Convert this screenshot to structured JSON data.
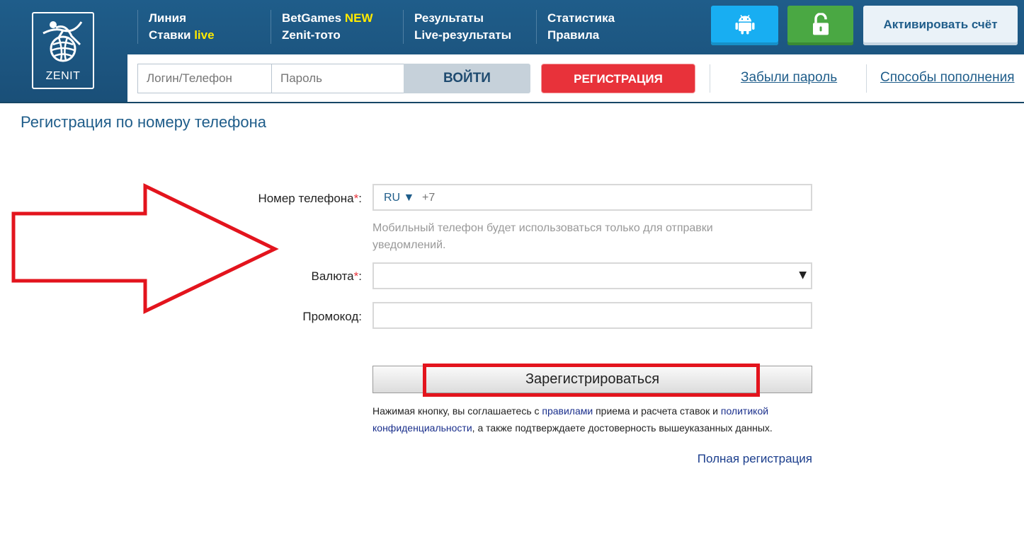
{
  "header": {
    "logo_text": "ZENIT",
    "nav": [
      {
        "line1": "Линия",
        "line2_pre": "Ставки ",
        "line2_hl": "live"
      },
      {
        "line1_pre": "BetGames ",
        "line1_hl": "NEW",
        "line2": "Zenit-тото"
      },
      {
        "line1": "Результаты",
        "line2": "Live-результаты"
      },
      {
        "line1": "Статистика",
        "line2": "Правила"
      }
    ],
    "activate_label": "Активировать счёт",
    "android_icon": "android-icon",
    "lock_icon": "unlock-icon"
  },
  "login_bar": {
    "login_placeholder": "Логин/Телефон",
    "password_placeholder": "Пароль",
    "login_button": "ВОЙТИ",
    "register_button": "РЕГИСТРАЦИЯ",
    "forgot_password": "Забыли пароль",
    "deposit_methods": "Способы пополнения"
  },
  "page": {
    "title": "Регистрация по номеру телефона"
  },
  "form": {
    "phone_label": "Номер телефона",
    "required_mark": "*",
    "colon": ":",
    "country_code": "RU ▼",
    "dial_prefix": "+7",
    "phone_hint": "Мобильный телефон будет использоваться только для отправки уведомлений.",
    "currency_label": "Валюта",
    "currency_value": "",
    "caret": "▼",
    "promo_label": "Промокод:",
    "promo_value": "",
    "submit_label": "Зарегистрироваться",
    "terms": {
      "t1": "Нажимая кнопку, вы соглашаетесь с ",
      "link_rules": "правилами",
      "t2": " приема и расчета ставок и ",
      "link_privacy_1": "политикой",
      "link_privacy_2": "конфиденциальности",
      "t3": ", а также подтверждаете достоверность вышеуказанных данных."
    },
    "full_registration": "Полная регистрация"
  },
  "colors": {
    "header_blue": "#1f5d8a",
    "register_red": "#e8323a",
    "android_blue": "#18aef2",
    "lock_green": "#4aa843",
    "annotation_red": "#e3141d",
    "highlight_yellow": "#ffea00"
  }
}
